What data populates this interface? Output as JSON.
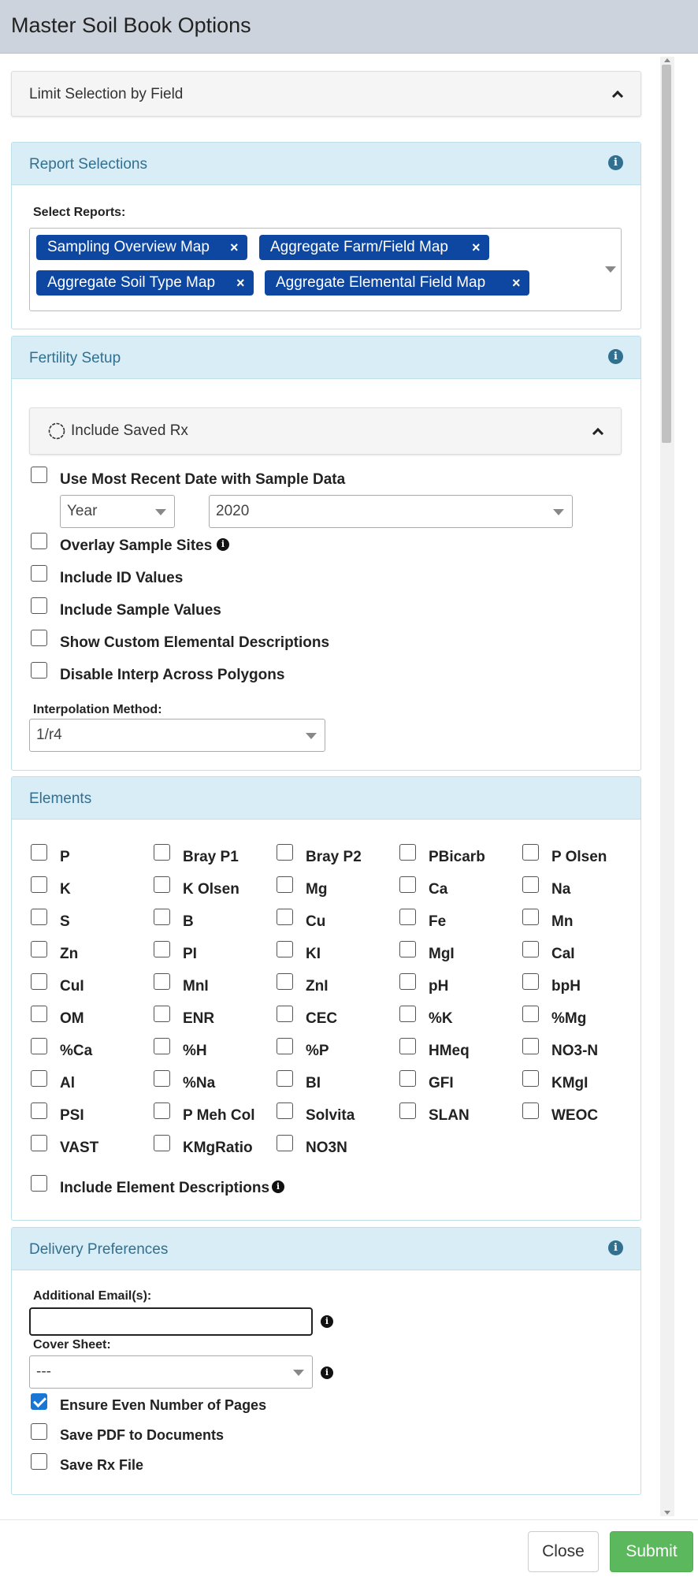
{
  "window": {
    "title": "Master Soil Book Options"
  },
  "limit_panel": {
    "title": "Limit Selection by Field"
  },
  "reports_panel": {
    "title": "Report Selections",
    "select_label": "Select Reports:",
    "tags": [
      "Sampling Overview Map",
      "Aggregate Farm/Field Map",
      "Aggregate Soil Type Map",
      "Aggregate Elemental Field Map"
    ],
    "remove_glyph": "×"
  },
  "fertility_panel": {
    "title": "Fertility Setup",
    "saved_rx": "Include Saved Rx",
    "options": [
      {
        "label": "Use Most Recent Date with Sample Data",
        "checked": false
      },
      {
        "label": "Overlay Sample Sites",
        "checked": false
      },
      {
        "label": "Include ID Values",
        "checked": false
      },
      {
        "label": "Include Sample Values",
        "checked": false
      },
      {
        "label": "Show Custom Elemental Descriptions",
        "checked": false
      },
      {
        "label": "Disable Interp Across Polygons",
        "checked": false
      }
    ],
    "period_select": "Year",
    "year_select": "2020",
    "interp_label": "Interpolation Method:",
    "interp_value": "1/r4"
  },
  "elements_panel": {
    "title": "Elements",
    "items": [
      "P",
      "Bray P1",
      "Bray P2",
      "PBicarb",
      "P Olsen",
      "K",
      "K Olsen",
      "Mg",
      "Ca",
      "Na",
      "S",
      "B",
      "Cu",
      "Fe",
      "Mn",
      "Zn",
      "PI",
      "KI",
      "MgI",
      "CaI",
      "CuI",
      "MnI",
      "ZnI",
      "pH",
      "bpH",
      "OM",
      "ENR",
      "CEC",
      "%K",
      "%Mg",
      "%Ca",
      "%H",
      "%P",
      "HMeq",
      "NO3-N",
      "Al",
      "%Na",
      "BI",
      "GFI",
      "KMgI",
      "PSI",
      "P Meh Col",
      "Solvita",
      "SLAN",
      "WEOC",
      "VAST",
      "KMgRatio",
      "NO3N"
    ],
    "include_desc": "Include Element Descriptions"
  },
  "delivery_panel": {
    "title": "Delivery Preferences",
    "email_label": "Additional Email(s):",
    "email_value": "",
    "cover_label": "Cover Sheet:",
    "cover_value": "---",
    "options": [
      {
        "label": "Ensure Even Number of Pages",
        "checked": true
      },
      {
        "label": "Save PDF to Documents",
        "checked": false
      },
      {
        "label": "Save Rx File",
        "checked": false
      }
    ]
  },
  "footer": {
    "close": "Close",
    "submit": "Submit"
  },
  "icons": {
    "info": "i"
  },
  "colors": {
    "panel_head": "#d9edf7",
    "panel_title": "#31708f",
    "tag_bg": "#0d47a1",
    "submit": "#5cb85c",
    "checkbox_checked": "#1976d2"
  }
}
